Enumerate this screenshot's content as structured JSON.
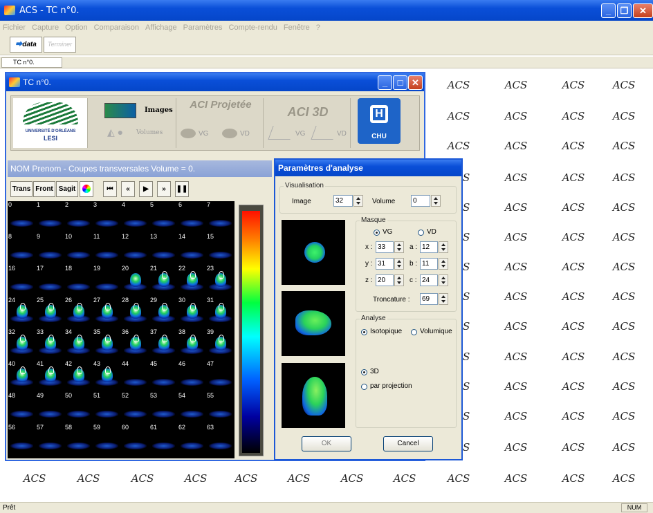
{
  "app": {
    "title": "ACS - TC n°0.",
    "accent": "#0a4fd8"
  },
  "menu": [
    "Fichier",
    "Capture",
    "Option",
    "Comparaison",
    "Affichage",
    "Paramètres",
    "Compte-rendu",
    "Fenêtre",
    "?"
  ],
  "toolbar": {
    "data_label": "data",
    "terminer_label": "Terminer"
  },
  "doc_tab": "TC n°0.",
  "background_label": "ACS",
  "doc_window": {
    "title": "TC n°0.",
    "university": "UNIVERSITÉ D'ORLÉANS",
    "lab": "LESI",
    "images_label": "Images",
    "volumes_label": "Volumes",
    "aci_projetee": "ACI Projetée",
    "aci_3d": "ACI 3D",
    "vg": "VG",
    "vd": "VD",
    "chu": "CHU"
  },
  "images_panel": {
    "title": "NOM Prenom -  Coupes transversales   Volume = 0.",
    "view_buttons": [
      "Trans",
      "Front",
      "Sagit"
    ],
    "slice_numbers": [
      "0",
      "1",
      "2",
      "3",
      "4",
      "5",
      "6",
      "7",
      "8",
      "9",
      "10",
      "11",
      "12",
      "13",
      "14",
      "15",
      "16",
      "17",
      "18",
      "19",
      "20",
      "21",
      "22",
      "23",
      "24",
      "25",
      "26",
      "27",
      "28",
      "29",
      "30",
      "31",
      "32",
      "33",
      "34",
      "35",
      "36",
      "37",
      "38",
      "39",
      "40",
      "41",
      "42",
      "43",
      "44",
      "45",
      "46",
      "47",
      "48",
      "49",
      "50",
      "51",
      "52",
      "53",
      "54",
      "55",
      "56",
      "57",
      "58",
      "59",
      "60",
      "61",
      "62",
      "63"
    ]
  },
  "dialog": {
    "title": "Paramètres d'analyse",
    "visualisation": "Visualisation",
    "image_label": "Image",
    "image_value": "32",
    "volume_label": "Volume",
    "volume_value": "0",
    "masque": "Masque",
    "vg": "VG",
    "vd": "VD",
    "x_label": "x :",
    "x_value": "33",
    "y_label": "y :",
    "y_value": "31",
    "z_label": "z :",
    "z_value": "20",
    "a_label": "a :",
    "a_value": "12",
    "b_label": "b :",
    "b_value": "11",
    "c_label": "c :",
    "c_value": "24",
    "troncature_label": "Troncature :",
    "troncature_value": "69",
    "analyse": "Analyse",
    "isotopique": "Isotopique",
    "volumique": "Volumique",
    "mode_3d": "3D",
    "par_projection": "par projection",
    "ok": "OK",
    "cancel": "Cancel"
  },
  "status": {
    "text": "Prêt",
    "num": "NUM"
  }
}
